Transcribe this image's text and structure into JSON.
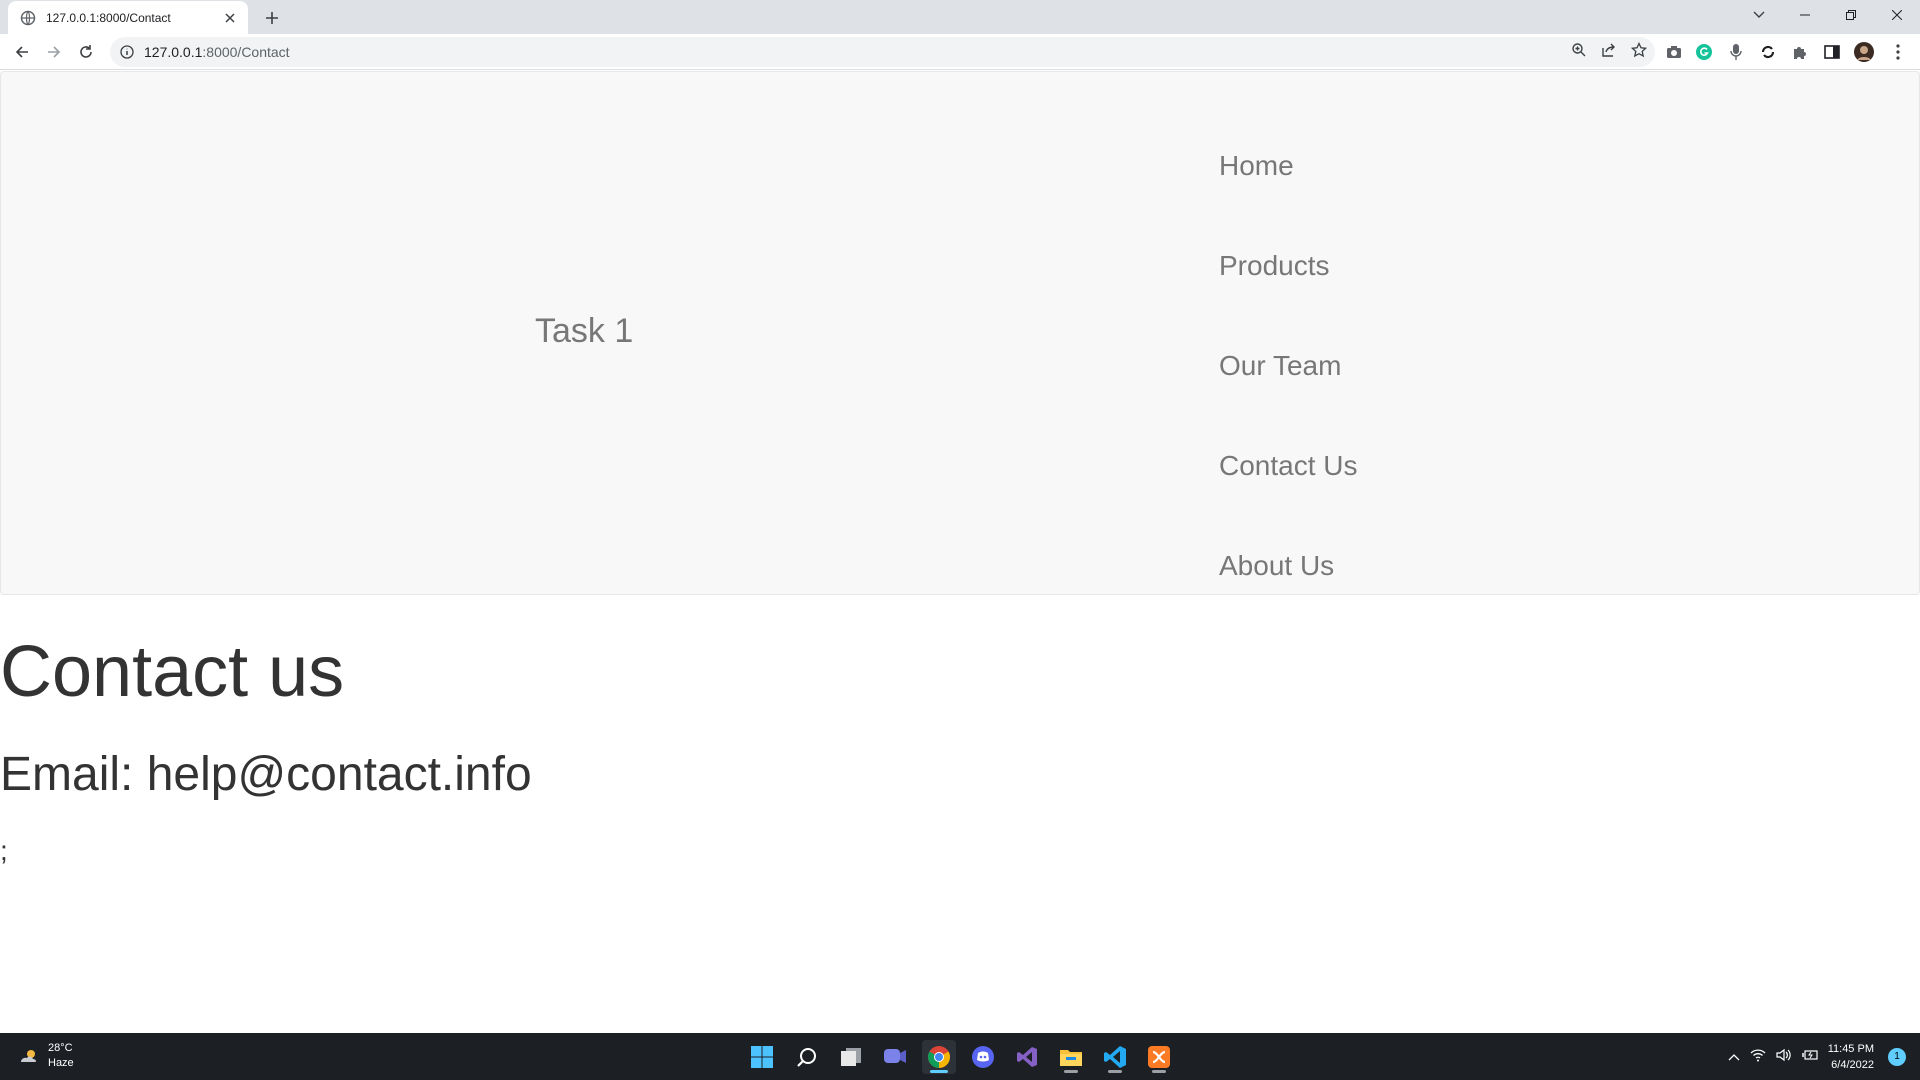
{
  "browser": {
    "tab_title": "127.0.0.1:8000/Contact",
    "url_host": "127.0.0.1",
    "url_path": ":8000/Contact",
    "icons": {
      "tab": [
        "globe-icon",
        "close-icon",
        "plus-icon"
      ],
      "window": [
        "chevron-down-icon",
        "minimize-icon",
        "restore-icon",
        "close-icon"
      ],
      "nav": [
        "back-arrow-icon",
        "forward-arrow-icon",
        "reload-icon",
        "info-icon"
      ],
      "omnibox": [
        "zoom-icon",
        "share-icon",
        "star-icon"
      ],
      "extensions": [
        "camera-icon",
        "grammarly-icon",
        "mic-icon",
        "sync-icon",
        "puzzle-icon",
        "sidepanel-icon",
        "profile-avatar",
        "kebab-menu-icon"
      ]
    }
  },
  "site": {
    "brand": "Task 1",
    "nav": [
      "Home",
      "Products",
      "Our Team",
      "Contact Us",
      "About Us"
    ]
  },
  "content": {
    "title": "Contact us",
    "email": "Email: help@contact.info",
    "stray": ";"
  },
  "taskbar": {
    "weather_temp": "28°C",
    "weather_desc": "Haze",
    "time": "11:45 PM",
    "date": "6/4/2022",
    "notification_count": "1",
    "apps": [
      "windows-start-icon",
      "search-icon",
      "task-view-icon",
      "teams-chat-icon",
      "chrome-icon",
      "discord-icon",
      "visual-studio-icon",
      "file-explorer-icon",
      "vscode-icon",
      "xampp-icon"
    ],
    "active_app": "chrome-icon",
    "accent": "#60cdff"
  }
}
